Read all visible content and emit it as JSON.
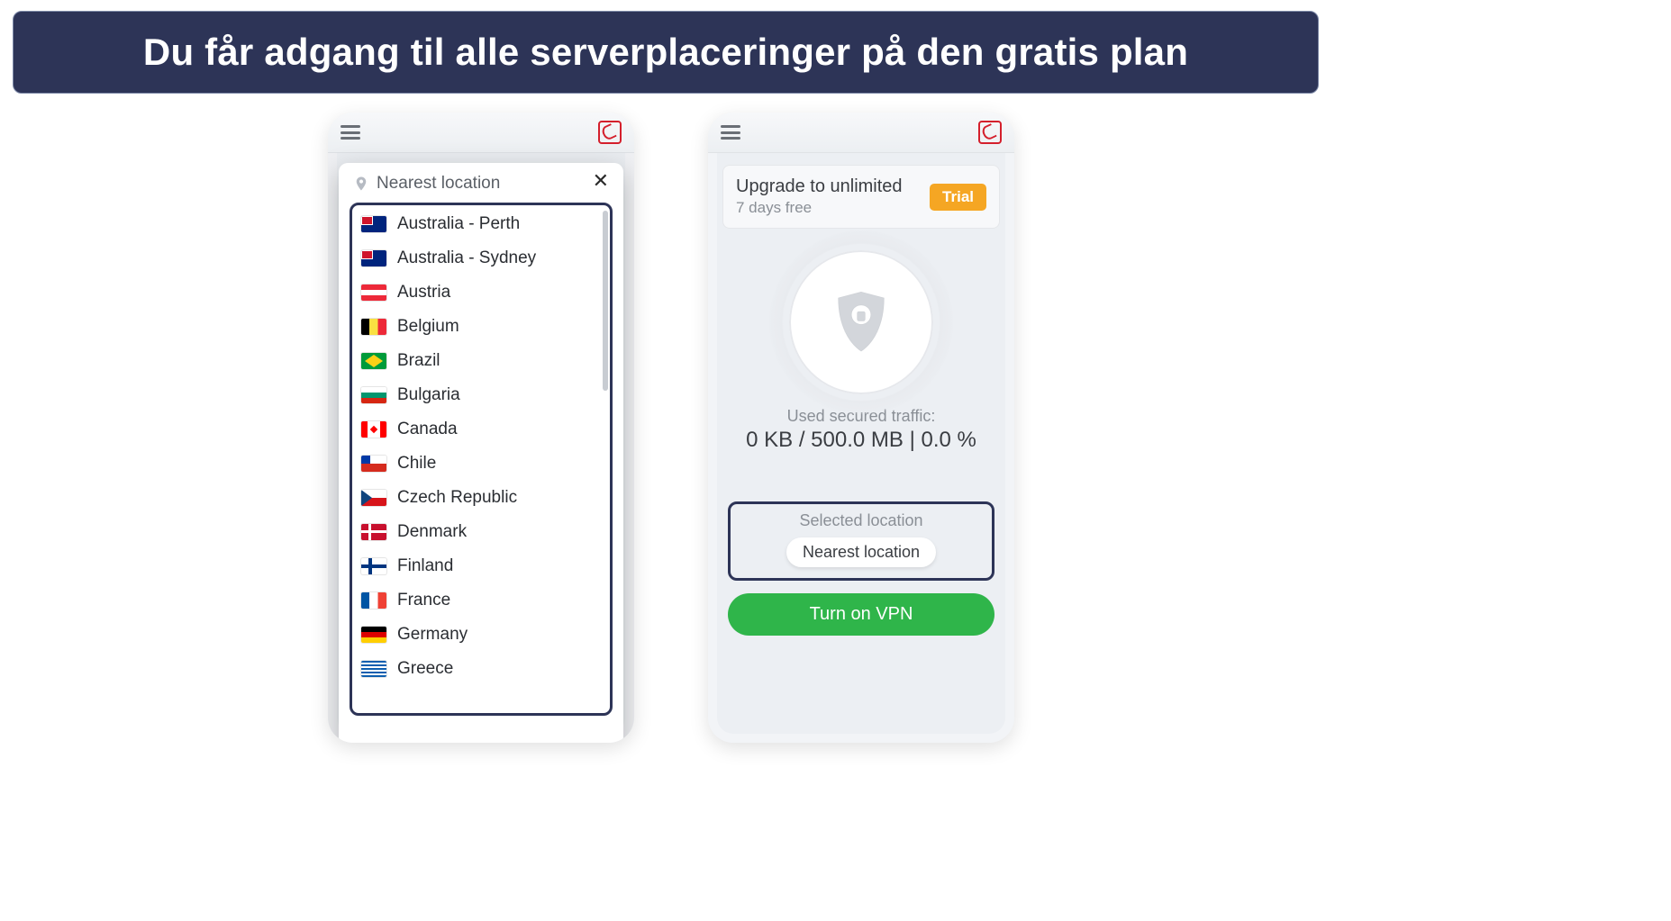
{
  "banner": {
    "headline": "Du får adgang til alle serverplaceringer på den gratis plan"
  },
  "left": {
    "nearest_label": "Nearest location",
    "locations": [
      {
        "flag": "au",
        "name": "Australia - Perth"
      },
      {
        "flag": "au",
        "name": "Australia - Sydney"
      },
      {
        "flag": "at",
        "name": "Austria"
      },
      {
        "flag": "be",
        "name": "Belgium"
      },
      {
        "flag": "br",
        "name": "Brazil"
      },
      {
        "flag": "bg",
        "name": "Bulgaria"
      },
      {
        "flag": "ca",
        "name": "Canada"
      },
      {
        "flag": "cl",
        "name": "Chile"
      },
      {
        "flag": "cz",
        "name": "Czech Republic"
      },
      {
        "flag": "dk",
        "name": "Denmark"
      },
      {
        "flag": "fi",
        "name": "Finland"
      },
      {
        "flag": "fr",
        "name": "France"
      },
      {
        "flag": "de",
        "name": "Germany"
      },
      {
        "flag": "gr",
        "name": "Greece"
      }
    ]
  },
  "right": {
    "upgrade_title": "Upgrade to unlimited",
    "upgrade_sub": "7 days free",
    "trial_badge": "Trial",
    "traffic_label": "Used secured traffic:",
    "traffic_value": "0 KB / 500.0 MB  |  0.0 %",
    "selected_label": "Selected location",
    "selected_value": "Nearest location",
    "turn_on_label": "Turn on VPN"
  }
}
